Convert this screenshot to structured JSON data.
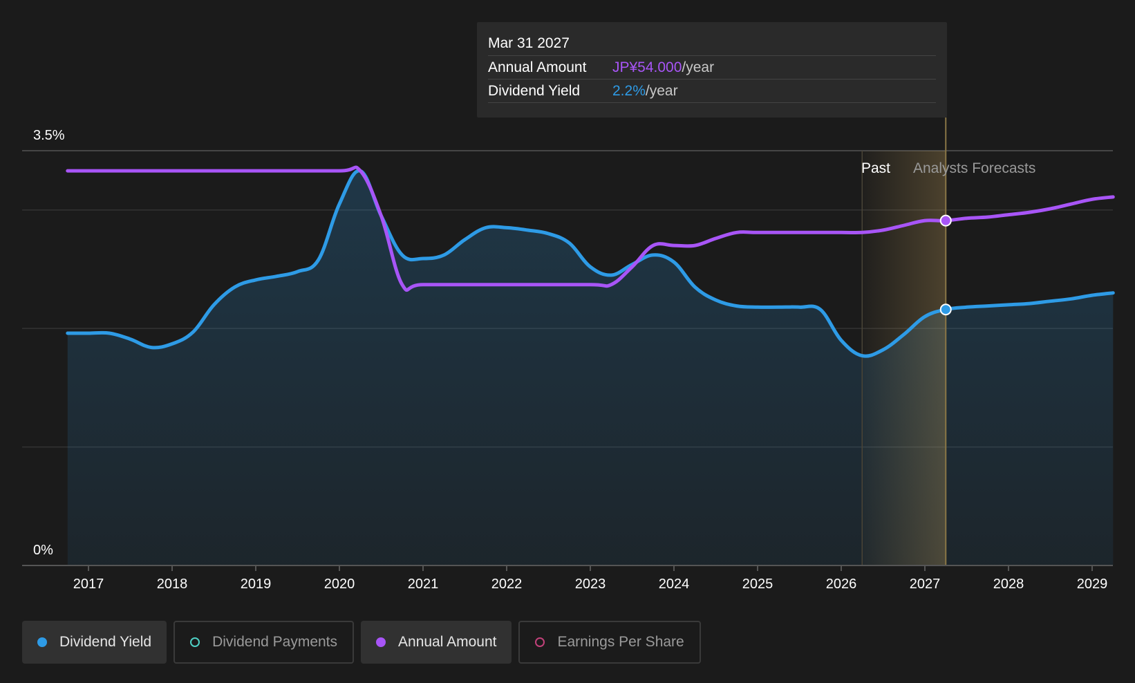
{
  "colors": {
    "background": "#1b1b1b",
    "dividend_yield": "#2e9be6",
    "annual_amount": "#a855f7",
    "dividend_payments": "#4fd1c5",
    "earnings_per_share": "#c2417a",
    "forecast_band": "#c9a45c"
  },
  "tooltip": {
    "date": "Mar 31 2027",
    "rows": [
      {
        "label": "Annual Amount",
        "value": "JP¥54.000",
        "unit": "/year"
      },
      {
        "label": "Dividend Yield",
        "value": "2.2%",
        "unit": "/year"
      }
    ]
  },
  "regions": {
    "past_label": "Past",
    "forecast_label": "Analysts Forecasts"
  },
  "legend": [
    {
      "label": "Dividend Yield",
      "icon": "filled-dot-icon",
      "color": "#2e9be6",
      "active": true
    },
    {
      "label": "Dividend Payments",
      "icon": "hollow-dot-icon",
      "color": "#4fd1c5",
      "active": false
    },
    {
      "label": "Annual Amount",
      "icon": "filled-dot-icon",
      "color": "#a855f7",
      "active": true
    },
    {
      "label": "Earnings Per Share",
      "icon": "hollow-dot-icon",
      "color": "#c2417a",
      "active": false
    }
  ],
  "chart_data": {
    "type": "line",
    "y_tick_labels": [
      "3.5%",
      "0%"
    ],
    "ylim": [
      0,
      3.5
    ],
    "xlim": [
      2016.5,
      2029.25
    ],
    "x_tick_labels": [
      "2017",
      "2018",
      "2019",
      "2020",
      "2021",
      "2022",
      "2023",
      "2024",
      "2025",
      "2026",
      "2027",
      "2028",
      "2029"
    ],
    "grid": true,
    "past_end": 2026.25,
    "highlight_x": 2027.25,
    "series": [
      {
        "name": "Dividend Yield",
        "color": "#2e9be6",
        "area": true,
        "points": [
          [
            2016.75,
            1.96
          ],
          [
            2017.0,
            1.96
          ],
          [
            2017.25,
            1.96
          ],
          [
            2017.5,
            1.91
          ],
          [
            2017.75,
            1.84
          ],
          [
            2018.0,
            1.87
          ],
          [
            2018.25,
            1.97
          ],
          [
            2018.5,
            2.2
          ],
          [
            2018.75,
            2.35
          ],
          [
            2019.0,
            2.41
          ],
          [
            2019.25,
            2.44
          ],
          [
            2019.5,
            2.48
          ],
          [
            2019.75,
            2.58
          ],
          [
            2020.0,
            3.05
          ],
          [
            2020.25,
            3.33
          ],
          [
            2020.5,
            2.95
          ],
          [
            2020.75,
            2.62
          ],
          [
            2021.0,
            2.59
          ],
          [
            2021.25,
            2.62
          ],
          [
            2021.5,
            2.75
          ],
          [
            2021.75,
            2.85
          ],
          [
            2022.0,
            2.85
          ],
          [
            2022.25,
            2.83
          ],
          [
            2022.5,
            2.8
          ],
          [
            2022.75,
            2.72
          ],
          [
            2023.0,
            2.52
          ],
          [
            2023.25,
            2.45
          ],
          [
            2023.5,
            2.54
          ],
          [
            2023.75,
            2.62
          ],
          [
            2024.0,
            2.56
          ],
          [
            2024.25,
            2.35
          ],
          [
            2024.5,
            2.24
          ],
          [
            2024.75,
            2.19
          ],
          [
            2025.0,
            2.18
          ],
          [
            2025.25,
            2.18
          ],
          [
            2025.5,
            2.18
          ],
          [
            2025.75,
            2.16
          ],
          [
            2026.0,
            1.9
          ],
          [
            2026.25,
            1.77
          ],
          [
            2026.5,
            1.82
          ],
          [
            2026.75,
            1.95
          ],
          [
            2027.0,
            2.1
          ],
          [
            2027.25,
            2.16
          ],
          [
            2027.5,
            2.18
          ],
          [
            2027.75,
            2.19
          ],
          [
            2028.0,
            2.2
          ],
          [
            2028.25,
            2.21
          ],
          [
            2028.5,
            2.23
          ],
          [
            2028.75,
            2.25
          ],
          [
            2029.0,
            2.28
          ],
          [
            2029.25,
            2.3
          ]
        ]
      },
      {
        "name": "Annual Amount",
        "color": "#a855f7",
        "area": false,
        "points": [
          [
            2016.75,
            3.33
          ],
          [
            2017.0,
            3.33
          ],
          [
            2018.0,
            3.33
          ],
          [
            2019.0,
            3.33
          ],
          [
            2020.0,
            3.33
          ],
          [
            2020.25,
            3.33
          ],
          [
            2020.5,
            2.95
          ],
          [
            2020.75,
            2.37
          ],
          [
            2021.0,
            2.37
          ],
          [
            2022.0,
            2.37
          ],
          [
            2023.0,
            2.37
          ],
          [
            2023.25,
            2.37
          ],
          [
            2023.5,
            2.52
          ],
          [
            2023.75,
            2.7
          ],
          [
            2024.0,
            2.7
          ],
          [
            2024.25,
            2.7
          ],
          [
            2024.5,
            2.76
          ],
          [
            2024.75,
            2.81
          ],
          [
            2025.0,
            2.81
          ],
          [
            2025.5,
            2.81
          ],
          [
            2026.0,
            2.81
          ],
          [
            2026.25,
            2.81
          ],
          [
            2026.5,
            2.83
          ],
          [
            2026.75,
            2.87
          ],
          [
            2027.0,
            2.91
          ],
          [
            2027.25,
            2.91
          ],
          [
            2027.5,
            2.93
          ],
          [
            2027.75,
            2.94
          ],
          [
            2028.0,
            2.96
          ],
          [
            2028.25,
            2.98
          ],
          [
            2028.5,
            3.01
          ],
          [
            2028.75,
            3.05
          ],
          [
            2029.0,
            3.09
          ],
          [
            2029.25,
            3.11
          ]
        ]
      }
    ],
    "highlight_points": [
      {
        "series": "Annual Amount",
        "x": 2027.25,
        "y": 2.91
      },
      {
        "series": "Dividend Yield",
        "x": 2027.25,
        "y": 2.16
      }
    ]
  }
}
